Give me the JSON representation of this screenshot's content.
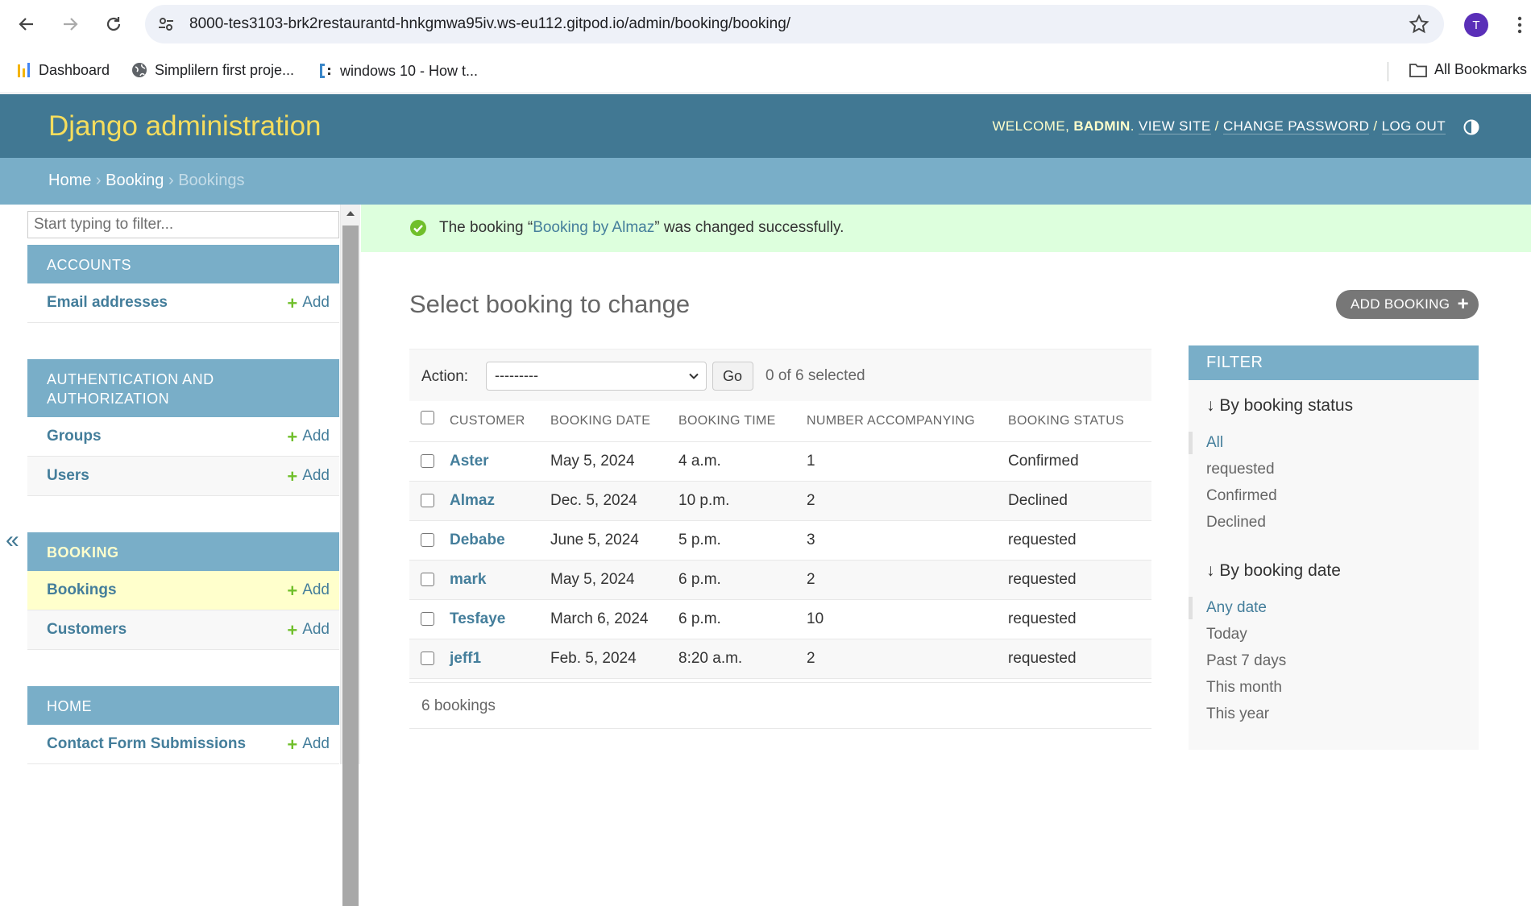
{
  "browser": {
    "url": "8000-tes3103-brk2restaurantd-hnkgmwa95iv.ws-eu112.gitpod.io/admin/booking/booking/",
    "profile_initial": "T",
    "bookmarks": [
      "Dashboard",
      "Simplilern first proje...",
      "windows 10 - How t..."
    ],
    "all_bookmarks": "All Bookmarks"
  },
  "header": {
    "brand": "Django administration",
    "welcome": "WELCOME,",
    "username": "BADMIN",
    "view_site": "VIEW SITE",
    "change_password": "CHANGE PASSWORD",
    "log_out": "LOG OUT"
  },
  "breadcrumbs": [
    "Home",
    "Booking",
    "Bookings"
  ],
  "sidebar": {
    "filter_placeholder": "Start typing to filter...",
    "collapse": "«",
    "add_label": "Add",
    "modules": [
      {
        "caption": "ACCOUNTS",
        "models": [
          "Email addresses"
        ]
      },
      {
        "caption": "AUTHENTICATION AND AUTHORIZATION",
        "models": [
          "Groups",
          "Users"
        ]
      },
      {
        "caption": "BOOKING",
        "models": [
          "Bookings",
          "Customers"
        ]
      },
      {
        "caption": "HOME",
        "models": [
          "Contact Form Submissions"
        ]
      }
    ]
  },
  "message": {
    "prefix": "The booking “",
    "link": "Booking by Almaz",
    "suffix": "” was changed successfully."
  },
  "content": {
    "title": "Select booking to change",
    "add_button": "ADD BOOKING",
    "action_label": "Action:",
    "action_value": "---------",
    "go": "Go",
    "selected": "0 of 6 selected",
    "columns": [
      "CUSTOMER",
      "BOOKING DATE",
      "BOOKING TIME",
      "NUMBER ACCOMPANYING",
      "BOOKING STATUS"
    ],
    "rows": [
      [
        "Aster",
        "May 5, 2024",
        "4 a.m.",
        "1",
        "Confirmed"
      ],
      [
        "Almaz",
        "Dec. 5, 2024",
        "10 p.m.",
        "2",
        "Declined"
      ],
      [
        "Debabe",
        "June 5, 2024",
        "5 p.m.",
        "3",
        "requested"
      ],
      [
        "mark",
        "May 5, 2024",
        "6 p.m.",
        "2",
        "requested"
      ],
      [
        "Tesfaye",
        "March 6, 2024",
        "6 p.m.",
        "10",
        "requested"
      ],
      [
        "jeff1",
        "Feb. 5, 2024",
        "8:20 a.m.",
        "2",
        "requested"
      ]
    ],
    "count": "6 bookings"
  },
  "filter": {
    "title": "FILTER",
    "groups": [
      {
        "title": "↓ By booking status",
        "options": [
          "All",
          "requested",
          "Confirmed",
          "Declined"
        ],
        "selected": 0
      },
      {
        "title": "↓ By booking date",
        "options": [
          "Any date",
          "Today",
          "Past 7 days",
          "This month",
          "This year"
        ],
        "selected": 0
      }
    ]
  },
  "colors": {
    "header": "#417893",
    "accent": "#79aec8",
    "brand": "#f5dd5d",
    "link": "#447e9b",
    "success_bg": "#ddffdd"
  }
}
